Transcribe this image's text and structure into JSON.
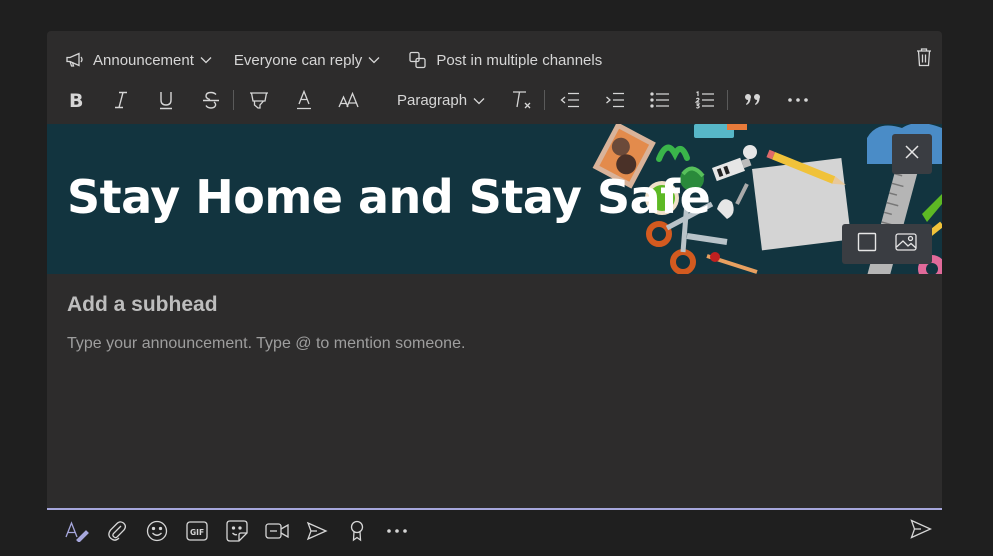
{
  "toolbar": {
    "post_type": {
      "label": "Announcement",
      "icon": "megaphone-icon"
    },
    "reply": {
      "label": "Everyone can reply",
      "icon": "chevron-down-icon"
    },
    "multi_channel": {
      "label": "Post in multiple channels",
      "icon": "copy-icon"
    },
    "delete": {
      "icon": "trash-icon"
    }
  },
  "format_toolbar": {
    "items": [
      "bold-icon",
      "italic-icon",
      "underline-icon",
      "strikethrough-icon",
      "highlight-icon",
      "font-color-icon",
      "font-size-icon"
    ],
    "paragraph_label": "Paragraph",
    "items_after": [
      "clear-formatting-icon",
      "decrease-indent-icon",
      "increase-indent-icon",
      "bulleted-list-icon",
      "numbered-list-icon",
      "quote-icon",
      "more-options-icon"
    ]
  },
  "banner": {
    "headline": "Stay Home and Stay Safe",
    "background_color": "#12343f"
  },
  "body": {
    "subhead_placeholder": "Add a subhead",
    "message_placeholder": "Type your announcement. Type @ to mention someone."
  },
  "bottom_toolbar": {
    "items": [
      "format-icon",
      "attach-icon",
      "emoji-icon",
      "gif-icon",
      "sticker-icon",
      "meet-now-icon",
      "schedule-meeting-icon",
      "praise-icon",
      "more-icon"
    ],
    "send": "send-icon"
  },
  "colors": {
    "accent": "#a6a7dc",
    "panel": "#2d2c2c",
    "page": "#1f1f1f"
  }
}
